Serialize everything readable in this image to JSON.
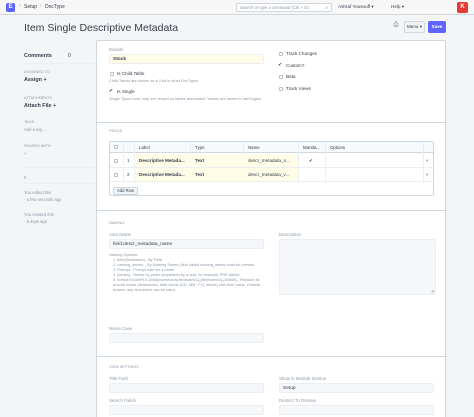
{
  "navbar": {
    "logo": "E",
    "crumbs": [
      "Setup",
      "DocType"
    ],
    "search_placeholder": "Search or type a command (Ctrl + G)",
    "user": "Ashraf Yousouff",
    "help": "Help",
    "avatar": "K"
  },
  "page": {
    "title": "Item Single Descriptive Metadata",
    "menu_label": "Menu",
    "save_label": "Save"
  },
  "sidebar": {
    "comments": "Comments",
    "comments_count": "0",
    "assigned_label": "Assigned To",
    "assign": "Assign",
    "attachments_label": "Attachments",
    "attach_file": "Attach File",
    "tags_label": "Tags",
    "add_tag": "Add a tag ...",
    "shared_label": "Shared With",
    "followers_count": "0",
    "activity": [
      {
        "who": "You",
        "action": "edited this",
        "when": "a few seconds ago"
      },
      {
        "who": "You",
        "action": "created this",
        "when": "5 days ago"
      }
    ]
  },
  "form": {
    "module_label": "Module",
    "module_value": "Stock",
    "is_child_table": "Is Child Table",
    "is_child_table_help": "Child Tables are shown as a Grid in other DocTypes",
    "is_single": "Is Single",
    "is_single_help": "Single Types have only one record no tables associated. Values are stored in tabSingles",
    "track_changes": "Track Changes",
    "custom": "Custom?",
    "beta": "Beta",
    "track_views": "Track Views"
  },
  "fields_section": {
    "heading": "Fields",
    "columns": [
      "Label",
      "Type",
      "Name",
      "Manda...",
      "Options"
    ],
    "rows": [
      {
        "no": "1",
        "label": "Descriptive Metada...",
        "type": "Text",
        "name": "descr_metadata_n...",
        "mandatory": "✔",
        "options": ""
      },
      {
        "no": "2",
        "label": "Descriptive Metada...",
        "type": "Text",
        "name": "descr_metadata_v...",
        "mandatory": "",
        "options": ""
      }
    ],
    "add_row": "Add Row"
  },
  "naming": {
    "heading": "Naming",
    "autoname_label": "Auto Name",
    "autoname_value": "field:descr_metadata_name",
    "description_label": "Description",
    "options_title": "Naming Options:",
    "options": [
      "1. field:[fieldname] - By Field",
      "2. naming_series: - By Naming Series (field called naming_series must be present",
      "3. Prompt - Prompt user for a name",
      "4. [series] - Series by prefix (separated by a dot); for example PRE.#####",
      "5. format:EXAMPLE-{MM}morewords{fieldname1}-{fieldname2}-{#####} - Replace all braced words (fieldnames, date words (DD, MM, YY), series) with their value. Outside braces, any characters can be used."
    ],
    "name_case_label": "Name Case"
  },
  "view_settings": {
    "heading": "View Settings",
    "title_field_label": "Title Field",
    "show_in_module_label": "Show in Module Section",
    "show_in_module_value": "Setup",
    "search_fields_label": "Search Fields",
    "restrict_label": "Restrict To Domain"
  },
  "colors": {
    "primary": "#5e64ff",
    "avatar": "#e53935",
    "highlight": "#fffde7"
  }
}
